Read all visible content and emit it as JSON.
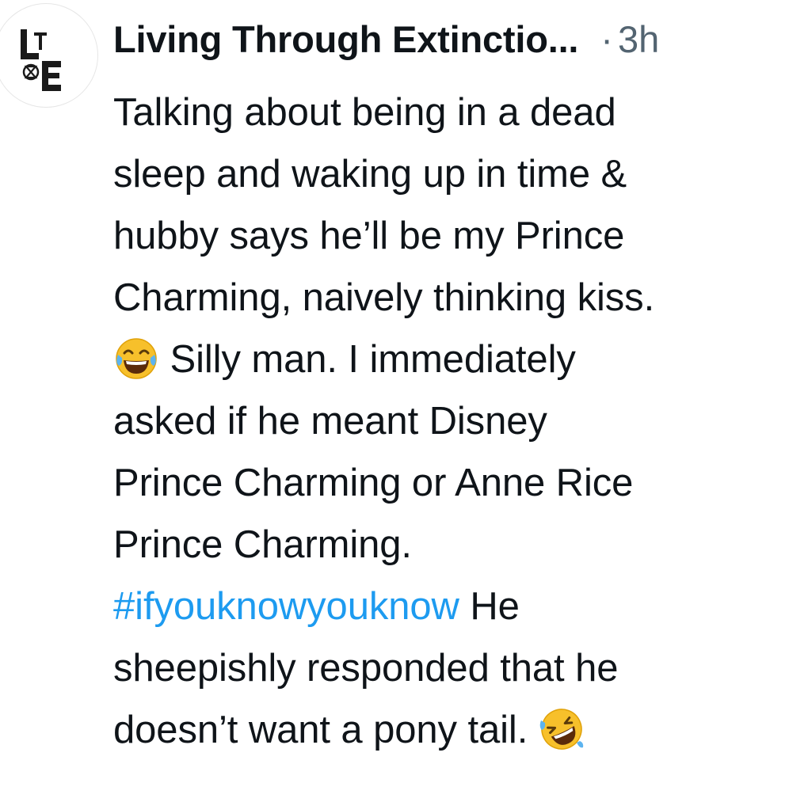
{
  "post": {
    "author_name": "Living Through Extinctio...",
    "separator": "·",
    "time_ago": "3h",
    "avatar_text": "LTE",
    "lines": {
      "l1": "Talking about being in a dead",
      "l2": "sleep and waking up in time &",
      "l3": "hubby says he’ll be my Prince",
      "l4": "Charming, naively thinking kiss.",
      "l5_text": " Silly man. I immediately",
      "l6": "asked if he meant Disney",
      "l7": "Prince Charming or Anne Rice",
      "l8": "Prince Charming.",
      "l9_hashtag": "#ifyouknowyouknow",
      "l9_text": " He",
      "l10": "sheepishly responded that he",
      "l11_text": "doesn’t want a pony tail. "
    },
    "emojis": [
      "face-with-tears-of-joy-icon",
      "rolling-on-the-floor-laughing-icon"
    ]
  },
  "colors": {
    "text": "#0f1419",
    "secondary": "#536471",
    "link": "#1d9bf0",
    "emoji_yellow": "#f7c02b",
    "tear_blue": "#5db4f0"
  }
}
